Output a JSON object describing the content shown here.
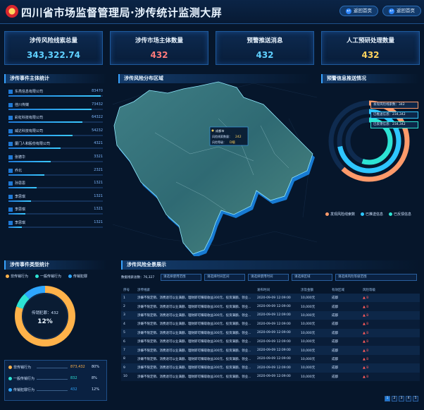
{
  "header": {
    "title": "四川省市场监督管理局·涉传统计监测大屏",
    "buttons": [
      "返回首页",
      "返回首页"
    ]
  },
  "kpis": [
    {
      "title": "涉传风险线索总量",
      "value": "343,322.74",
      "color": "#5fd0ff"
    },
    {
      "title": "涉传市场主体数量",
      "value": "432",
      "color": "#ff7a7a"
    },
    {
      "title": "预警推送消息",
      "value": "432",
      "color": "#5fd0ff"
    },
    {
      "title": "人工预研处理数量",
      "value": "432",
      "color": "#ffd35e"
    }
  ],
  "subjects": {
    "title": "涉传事件主体统计",
    "items": [
      {
        "name": "东亮信息有限公司",
        "value": "83470",
        "pct": 0.98
      },
      {
        "name": "佳川传媒",
        "value": "73432",
        "pct": 0.88
      },
      {
        "name": "彩虹科技有限公司",
        "value": "64322",
        "pct": 0.78
      },
      {
        "name": "威达科技有限公司",
        "value": "54232",
        "pct": 0.68
      },
      {
        "name": "厦门人和股份有限公司",
        "value": "4321",
        "pct": 0.55
      },
      {
        "name": "张德华",
        "value": "3321",
        "pct": 0.45
      },
      {
        "name": "乔北",
        "value": "2321",
        "pct": 0.38
      },
      {
        "name": "孙思思",
        "value": "1321",
        "pct": 0.3
      },
      {
        "name": "李思琪",
        "value": "1321",
        "pct": 0.24
      },
      {
        "name": "李思琪",
        "value": "1321",
        "pct": 0.18
      },
      {
        "name": "李思琪",
        "value": "1321",
        "pct": 0.14
      }
    ]
  },
  "map": {
    "title": "涉传风险分布区域",
    "tooltip": {
      "region": "成都市",
      "l1": "风险线索数量：",
      "v1": "242",
      "l2": "风险等级：",
      "v2": "D级"
    }
  },
  "push": {
    "title": "预警信息推送情况",
    "items": [
      {
        "label": "发现风险线索数：",
        "value": "342",
        "color": "#ff9a6a",
        "pct": 0.62
      },
      {
        "label": "已推送信息：",
        "value": "234,342",
        "color": "#2ec6ff",
        "pct": 0.72
      },
      {
        "label": "已反馈信息：",
        "value": "234,342",
        "color": "#2de3d3",
        "pct": 0.55
      }
    ],
    "legend": [
      "发现风险线索数",
      "已推送信息",
      "已反馈信息"
    ]
  },
  "types": {
    "title": "涉传事件类型统计",
    "legend": [
      {
        "label": "非传销行为",
        "color": "#ffb24a"
      },
      {
        "label": "一般传销行为",
        "color": "#2de3d3"
      },
      {
        "label": "传销犯罪",
        "color": "#2ea6ff"
      }
    ],
    "donut_label": "传销犯罪：432",
    "donut_pct": "12%",
    "rows": [
      {
        "name": "非传销行为",
        "value": "873,432",
        "pct": "80%",
        "color": "#ffb24a"
      },
      {
        "name": "一般传销行为",
        "value": "832",
        "pct": "8%",
        "color": "#2de3d3"
      },
      {
        "name": "传销犯罪行为",
        "value": "432",
        "pct": "12%",
        "color": "#2ea6ff"
      }
    ]
  },
  "clues": {
    "title": "涉传风险全景展示",
    "count_label": "数据线索总数：76,327",
    "filters": [
      "请选择使用范围",
      "请选择时间区间",
      "请选择使用时间",
      "请选择区域",
      "请选择风险等级范围"
    ],
    "columns": [
      "序号",
      "涉传线索",
      "发布时间",
      "涉及金额",
      "有效区域",
      "风险等级"
    ],
    "rows": [
      [
        "1",
        "涉嫌不限定销、消费退可以业满额、理财即可赚取收益300元、投资满额、领业...",
        "2020-09-09 12:09:00",
        "10,000元",
        "成都",
        "B"
      ],
      [
        "2",
        "涉嫌不限定销、消费退可以业满额、理财即可赚取收益300元、投资满额、领业...",
        "2020-09-09 12:09:00",
        "10,000元",
        "成都",
        "B"
      ],
      [
        "3",
        "涉嫌不限定销、消费退可以业满额、理财即可赚取收益300元、投资满额、领业...",
        "2020-09-09 12:09:00",
        "10,000元",
        "成都",
        "B"
      ],
      [
        "4",
        "涉嫌不限定销、消费退可以业满额、理财即可赚取收益300元、投资满额、领业...",
        "2020-09-09 12:09:00",
        "10,000元",
        "成都",
        "B"
      ],
      [
        "5",
        "涉嫌不限定销、消费退可以业满额、理财即可赚取收益300元、投资满额、领业...",
        "2020-09-09 12:09:00",
        "10,000元",
        "成都",
        "B"
      ],
      [
        "6",
        "涉嫌不限定销、消费退可以业满额、理财即可赚取收益300元、投资满额、领业...",
        "2020-09-09 12:09:00",
        "10,000元",
        "成都",
        "B"
      ],
      [
        "7",
        "涉嫌不限定销、消费退可以业满额、理财即可赚取收益300元、投资满额、领业...",
        "2020-09-09 12:09:00",
        "10,000元",
        "成都",
        "B"
      ],
      [
        "8",
        "涉嫌不限定销、消费退可以业满额、理财即可赚取收益300元、投资满额、领业...",
        "2020-09-09 12:09:00",
        "10,000元",
        "成都",
        "B"
      ],
      [
        "9",
        "涉嫌不限定销、消费退可以业满额、理财即可赚取收益300元、投资满额、领业...",
        "2020-09-09 12:09:00",
        "10,000元",
        "成都",
        "B"
      ],
      [
        "10",
        "涉嫌不限定销、消费退可以业满额、理财即可赚取收益300元、投资满额、领业...",
        "2020-09-09 12:09:00",
        "10,000元",
        "成都",
        "B"
      ]
    ],
    "pages": [
      "1",
      "2",
      "3",
      "4",
      "5"
    ]
  }
}
